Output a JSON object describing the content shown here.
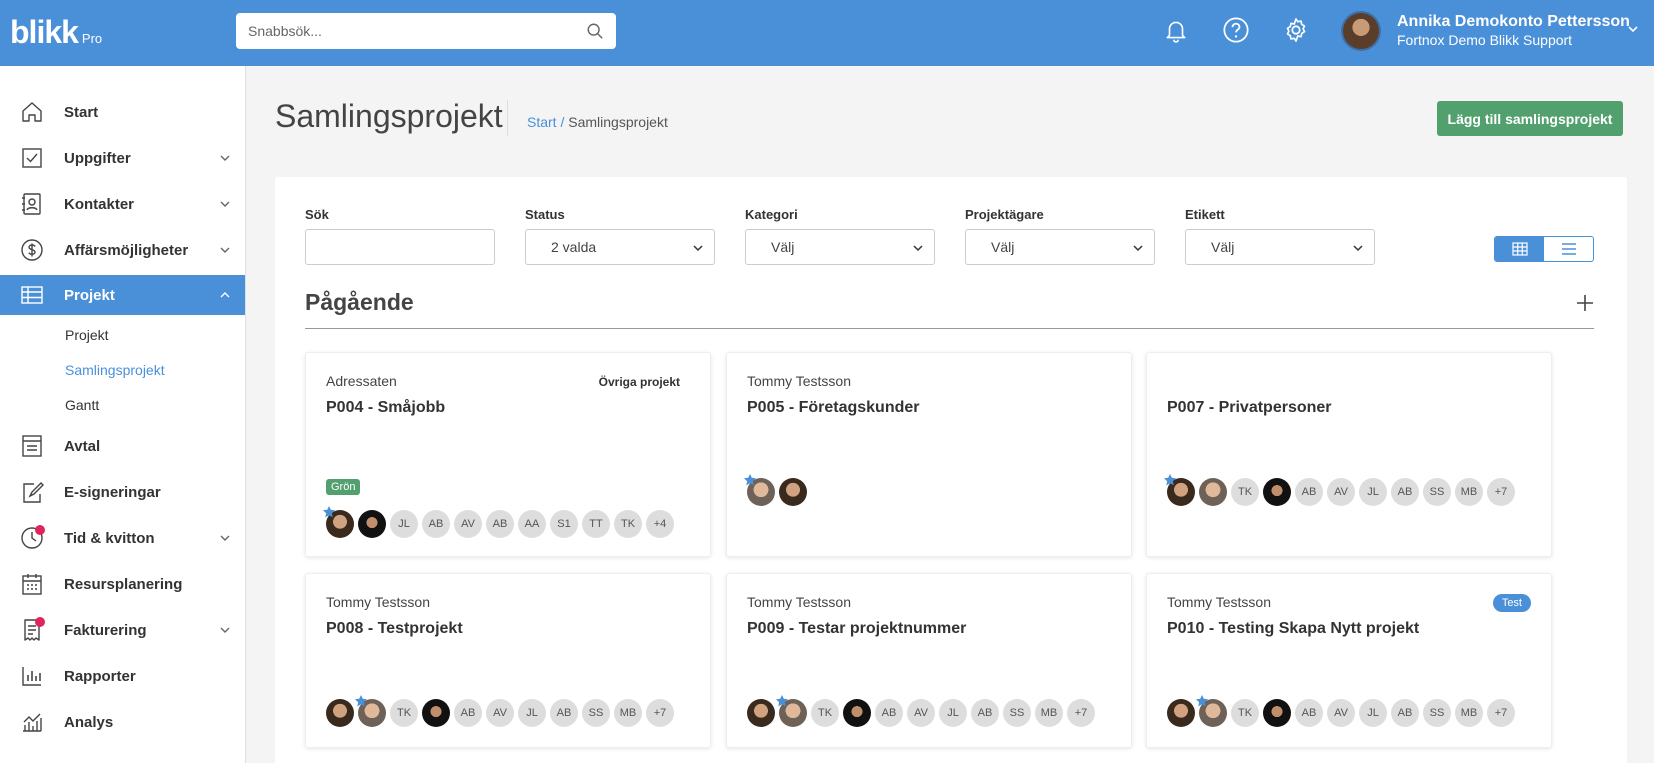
{
  "app": {
    "logo": "blikk",
    "logo_sub": "Pro",
    "search_placeholder": "Snabbsök...",
    "user_name": "Annika Demokonto Pettersson",
    "user_org": "Fortnox Demo Blikk Support"
  },
  "sidebar": {
    "items": [
      {
        "label": "Start",
        "icon": "home-icon"
      },
      {
        "label": "Uppgifter",
        "icon": "checkbox-icon"
      },
      {
        "label": "Kontakter",
        "icon": "contacts-icon"
      },
      {
        "label": "Affärsmöjligheter",
        "icon": "dollar-icon"
      },
      {
        "label": "Projekt",
        "icon": "table-icon"
      },
      {
        "label": "Avtal",
        "icon": "agreement-icon"
      },
      {
        "label": "E-signeringar",
        "icon": "signature-icon"
      },
      {
        "label": "Tid & kvitton",
        "icon": "clock-icon"
      },
      {
        "label": "Resursplanering",
        "icon": "calendar-icon"
      },
      {
        "label": "Fakturering",
        "icon": "invoice-icon"
      },
      {
        "label": "Rapporter",
        "icon": "bar-chart-icon"
      },
      {
        "label": "Analys",
        "icon": "analytics-icon"
      }
    ],
    "sub_items": [
      "Projekt",
      "Samlingsprojekt",
      "Gantt"
    ]
  },
  "page": {
    "title": "Samlingsprojekt",
    "breadcrumb_home": "Start",
    "breadcrumb_sep": "/",
    "breadcrumb_current": "Samlingsprojekt",
    "add_button": "Lägg till samlingsprojekt"
  },
  "filters": {
    "search_label": "Sök",
    "status_label": "Status",
    "status_value": "2 valda",
    "category_label": "Kategori",
    "category_value": "Välj",
    "owner_label": "Projektägare",
    "owner_value": "Välj",
    "tag_label": "Etikett",
    "tag_value": "Välj"
  },
  "section": {
    "title": "Pågående"
  },
  "cards": [
    {
      "client": "Adressaten",
      "name": "P004 - Småjobb",
      "category": "Övriga projekt",
      "tag": "Grön",
      "members": [
        "JL",
        "AB",
        "AV",
        "AB",
        "AA",
        "S1",
        "TT",
        "TK",
        "+4"
      ]
    },
    {
      "client": "Tommy Testsson",
      "name": "P005 - Företagskunder",
      "members": []
    },
    {
      "client": "",
      "name": "P007 - Privatpersoner",
      "members": [
        "TK",
        "AB",
        "AV",
        "JL",
        "AB",
        "SS",
        "MB",
        "+7"
      ]
    },
    {
      "client": "Tommy Testsson",
      "name": "P008 - Testprojekt",
      "members": [
        "TK",
        "AB",
        "AV",
        "JL",
        "AB",
        "SS",
        "MB",
        "+7"
      ]
    },
    {
      "client": "Tommy Testsson",
      "name": "P009 - Testar projektnummer",
      "members": [
        "TK",
        "AB",
        "AV",
        "JL",
        "AB",
        "SS",
        "MB",
        "+7"
      ]
    },
    {
      "client": "Tommy Testsson",
      "name": "P010 - Testing Skapa Nytt projekt",
      "tag": "Test",
      "members": [
        "TK",
        "AB",
        "AV",
        "JL",
        "AB",
        "SS",
        "MB",
        "+7"
      ]
    }
  ],
  "colors": {
    "brand": "#4a90d9",
    "success": "#52a06d",
    "badge": "#e0245e"
  }
}
